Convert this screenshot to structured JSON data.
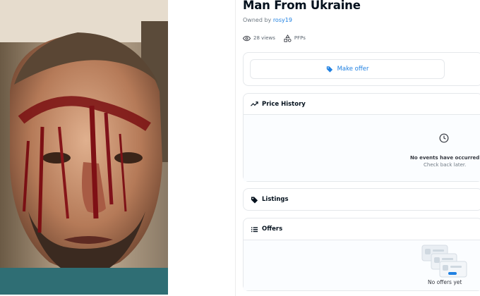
{
  "item": {
    "title": "Man From Ukraine",
    "owned_by_label": "Owned by",
    "owner_name": "rosy19",
    "views": "28 views",
    "collection_tag": "PFPs"
  },
  "offer_button": {
    "label": "Make offer",
    "icon": "tag-icon"
  },
  "price_history": {
    "title": "Price History",
    "icon": "trending-icon",
    "empty_icon": "clock-icon",
    "empty_title": "No events have occurred yet",
    "empty_subtitle": "Check back later."
  },
  "listings": {
    "title": "Listings",
    "icon": "tag-icon"
  },
  "offers": {
    "title": "Offers",
    "icon": "list-icon",
    "empty_text": "No offers yet"
  },
  "colors": {
    "accent": "#2081e2",
    "border": "#e5e8eb",
    "muted": "#707a83"
  }
}
